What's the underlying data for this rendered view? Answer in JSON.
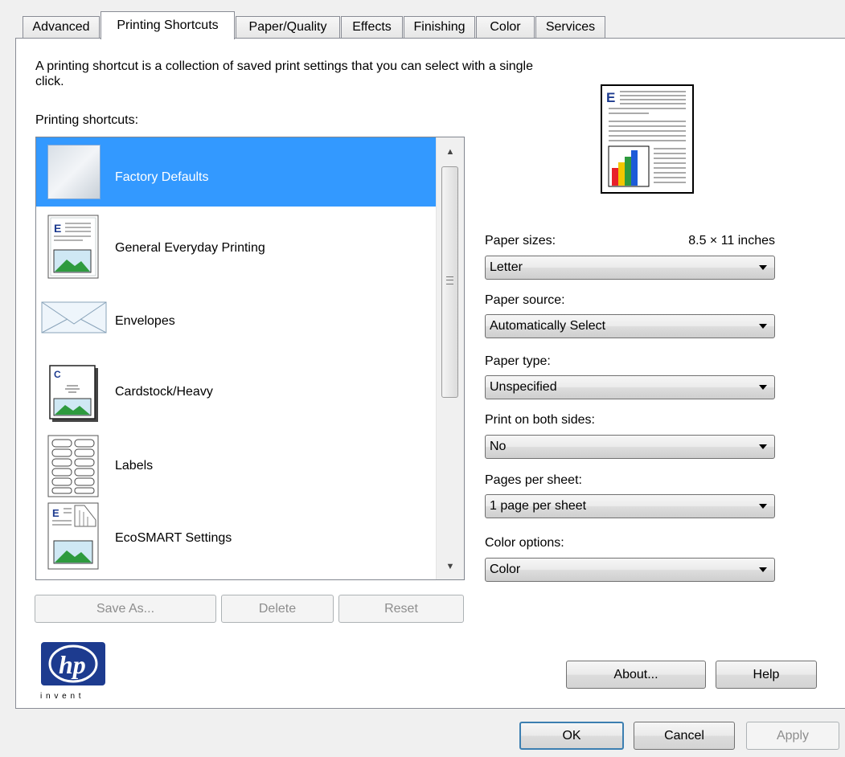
{
  "tabs": [
    {
      "label": "Advanced"
    },
    {
      "label": "Printing Shortcuts"
    },
    {
      "label": "Paper/Quality"
    },
    {
      "label": "Effects"
    },
    {
      "label": "Finishing"
    },
    {
      "label": "Color"
    },
    {
      "label": "Services"
    }
  ],
  "active_tab": "Printing Shortcuts",
  "description": "A printing shortcut is a collection of saved print settings that you can select with a single click.",
  "shortcuts_label": "Printing shortcuts:",
  "shortcuts": [
    {
      "label": "Factory Defaults",
      "icon": "factory-defaults-icon",
      "selected": true
    },
    {
      "label": "General Everyday Printing",
      "icon": "document-icon"
    },
    {
      "label": "Envelopes",
      "icon": "envelope-icon"
    },
    {
      "label": "Cardstock/Heavy",
      "icon": "cardstock-icon"
    },
    {
      "label": "Labels",
      "icon": "labels-icon"
    },
    {
      "label": "EcoSMART Settings",
      "icon": "ecosmart-icon"
    }
  ],
  "list_buttons": {
    "save_as": "Save As...",
    "delete": "Delete",
    "reset": "Reset"
  },
  "settings": {
    "paper_sizes": {
      "label": "Paper sizes:",
      "dimensions": "8.5 × 11 inches",
      "value": "Letter"
    },
    "paper_source": {
      "label": "Paper source:",
      "value": "Automatically Select"
    },
    "paper_type": {
      "label": "Paper type:",
      "value": "Unspecified"
    },
    "print_both_sides": {
      "label": "Print on both sides:",
      "value": "No"
    },
    "pages_per_sheet": {
      "label": "Pages per sheet:",
      "value": "1 page per sheet"
    },
    "color_options": {
      "label": "Color options:",
      "value": "Color"
    }
  },
  "logo": {
    "brand": "hp",
    "tagline": "i n v e n t"
  },
  "panel_buttons": {
    "about": "About...",
    "help": "Help"
  },
  "dialog_buttons": {
    "ok": "OK",
    "cancel": "Cancel",
    "apply": "Apply"
  },
  "colors": {
    "selection": "#3399ff",
    "hp_blue": "#1d3b8f"
  }
}
